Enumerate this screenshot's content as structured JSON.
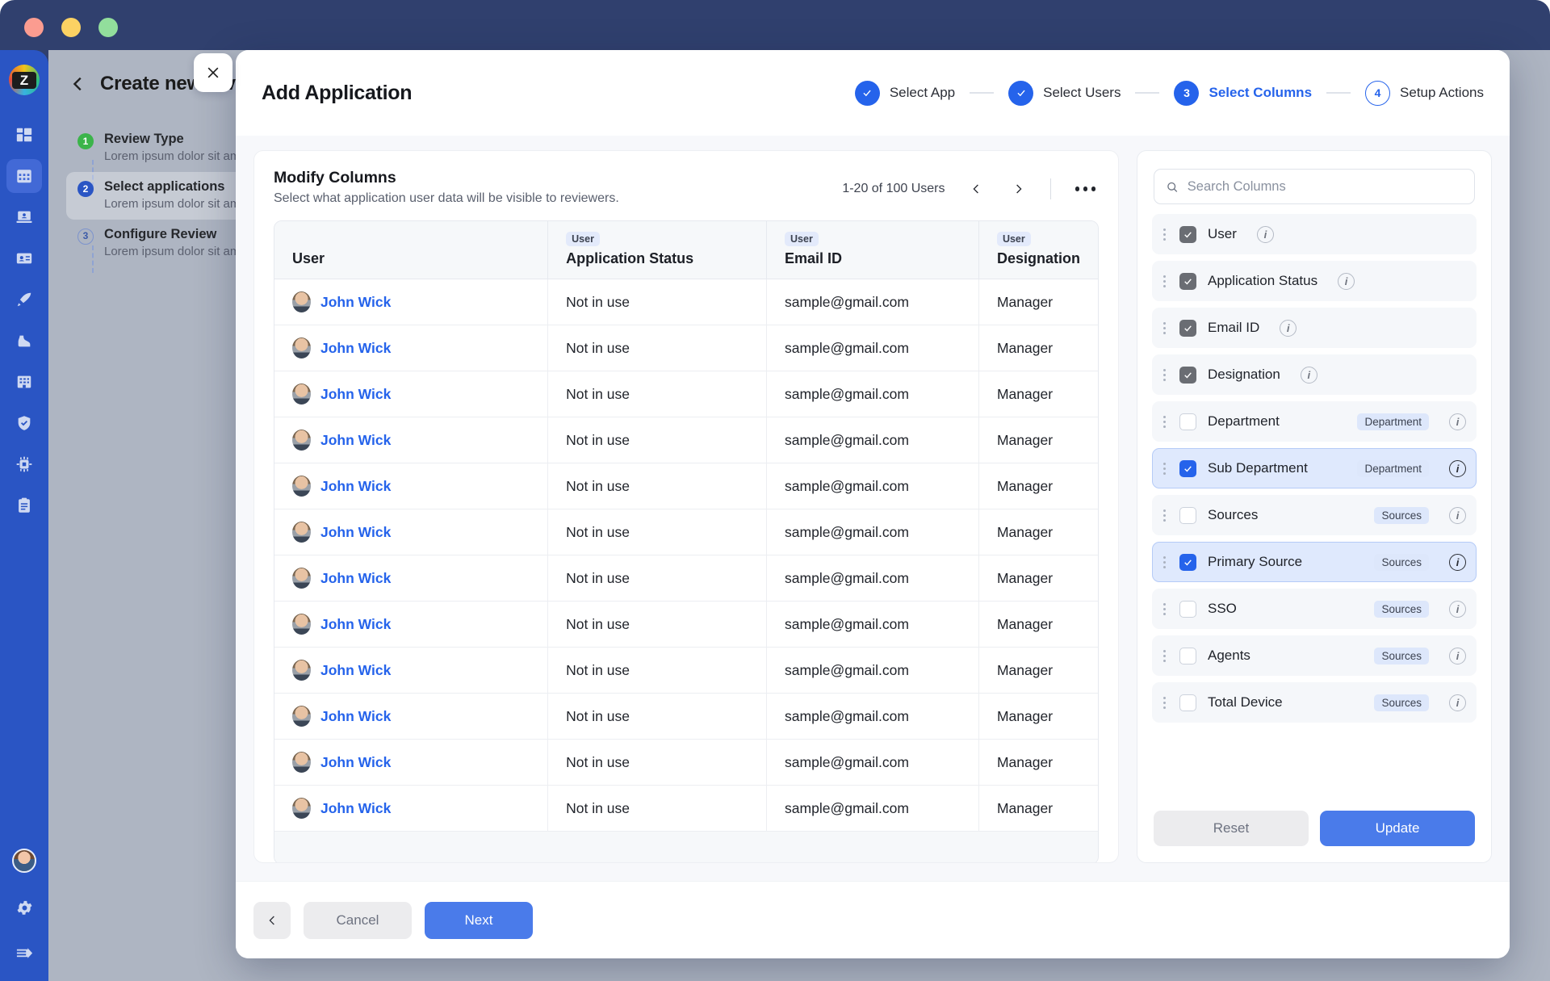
{
  "window": {
    "lights": [
      "close",
      "minimize",
      "maximize"
    ]
  },
  "rail": {
    "logo": "Z",
    "items": [
      {
        "name": "dashboard-icon",
        "active": false
      },
      {
        "name": "calendar-icon",
        "active": true
      },
      {
        "name": "id-card-icon",
        "active": false
      },
      {
        "name": "license-card-icon",
        "active": false
      },
      {
        "name": "rocket-icon",
        "active": false
      },
      {
        "name": "boot-step-icon",
        "active": false
      },
      {
        "name": "building-icon",
        "active": false
      },
      {
        "name": "shield-check-icon",
        "active": false
      },
      {
        "name": "chip-icon",
        "active": false
      },
      {
        "name": "clipboard-icon",
        "active": false
      }
    ],
    "bottom": [
      {
        "name": "user-avatar"
      },
      {
        "name": "settings-gear-icon"
      },
      {
        "name": "collapse-arrow-icon"
      }
    ]
  },
  "backdrop": {
    "breadcrumb": "Create new review",
    "steps": [
      {
        "num": "1",
        "state": "done",
        "title": "Review Type",
        "sub": "Lorem ipsum dolor sit amet"
      },
      {
        "num": "2",
        "state": "active",
        "title": "Select applications",
        "sub": "Lorem ipsum dolor sit amet"
      },
      {
        "num": "3",
        "state": "todo",
        "title": "Configure Review",
        "sub": "Lorem ipsum dolor sit amet"
      }
    ]
  },
  "modal": {
    "title": "Add Application",
    "close_label": "×",
    "stepper": [
      {
        "badge": "✓",
        "label": "Select App",
        "state": "done"
      },
      {
        "badge": "✓",
        "label": "Select Users",
        "state": "done"
      },
      {
        "badge": "3",
        "label": "Select Columns",
        "state": "current"
      },
      {
        "badge": "4",
        "label": "Setup Actions",
        "state": "upcoming"
      }
    ]
  },
  "table_panel": {
    "heading": "Modify Columns",
    "subheading": "Select what application user data will be visible to reviewers.",
    "pagination_text": "1-20 of 100 Users",
    "prev_label": "‹",
    "next_label": "›",
    "more_label": "•••",
    "columns": [
      {
        "chip": "",
        "name": "User"
      },
      {
        "chip": "User",
        "name": "Application Status"
      },
      {
        "chip": "User",
        "name": "Email ID"
      },
      {
        "chip": "User",
        "name": "Designation"
      }
    ],
    "rows": [
      {
        "user": "John Wick",
        "status": "Not in use",
        "email": "sample@gmail.com",
        "designation": "Manager"
      },
      {
        "user": "John Wick",
        "status": "Not in use",
        "email": "sample@gmail.com",
        "designation": "Manager"
      },
      {
        "user": "John Wick",
        "status": "Not in use",
        "email": "sample@gmail.com",
        "designation": "Manager"
      },
      {
        "user": "John Wick",
        "status": "Not in use",
        "email": "sample@gmail.com",
        "designation": "Manager"
      },
      {
        "user": "John Wick",
        "status": "Not in use",
        "email": "sample@gmail.com",
        "designation": "Manager"
      },
      {
        "user": "John Wick",
        "status": "Not in use",
        "email": "sample@gmail.com",
        "designation": "Manager"
      },
      {
        "user": "John Wick",
        "status": "Not in use",
        "email": "sample@gmail.com",
        "designation": "Manager"
      },
      {
        "user": "John Wick",
        "status": "Not in use",
        "email": "sample@gmail.com",
        "designation": "Manager"
      },
      {
        "user": "John Wick",
        "status": "Not in use",
        "email": "sample@gmail.com",
        "designation": "Manager"
      },
      {
        "user": "John Wick",
        "status": "Not in use",
        "email": "sample@gmail.com",
        "designation": "Manager"
      },
      {
        "user": "John Wick",
        "status": "Not in use",
        "email": "sample@gmail.com",
        "designation": "Manager"
      },
      {
        "user": "John Wick",
        "status": "Not in use",
        "email": "sample@gmail.com",
        "designation": "Manager"
      }
    ]
  },
  "columns_panel": {
    "search_placeholder": "Search Columns",
    "search_value": "",
    "items": [
      {
        "label": "User",
        "checked": true,
        "locked": true,
        "selected": false,
        "tag": ""
      },
      {
        "label": "Application Status",
        "checked": true,
        "locked": true,
        "selected": false,
        "tag": ""
      },
      {
        "label": "Email ID",
        "checked": true,
        "locked": true,
        "selected": false,
        "tag": ""
      },
      {
        "label": "Designation",
        "checked": true,
        "locked": true,
        "selected": false,
        "tag": ""
      },
      {
        "label": "Department",
        "checked": false,
        "locked": false,
        "selected": false,
        "tag": "Department"
      },
      {
        "label": "Sub Department",
        "checked": true,
        "locked": false,
        "selected": true,
        "tag": "Department"
      },
      {
        "label": "Sources",
        "checked": false,
        "locked": false,
        "selected": false,
        "tag": "Sources"
      },
      {
        "label": "Primary Source",
        "checked": true,
        "locked": false,
        "selected": true,
        "tag": "Sources"
      },
      {
        "label": "SSO",
        "checked": false,
        "locked": false,
        "selected": false,
        "tag": "Sources"
      },
      {
        "label": "Agents",
        "checked": false,
        "locked": false,
        "selected": false,
        "tag": "Sources"
      },
      {
        "label": "Total Device",
        "checked": false,
        "locked": false,
        "selected": false,
        "tag": "Sources"
      }
    ],
    "reset_label": "Reset",
    "update_label": "Update",
    "info_glyph": "i"
  },
  "footer": {
    "back_label": "‹",
    "cancel_label": "Cancel",
    "next_label": "Next"
  },
  "colors": {
    "chrome_navy": "#30406e",
    "rail_blue": "#2a55c4",
    "accent_blue": "#2563eb",
    "button_blue": "#4a7bea",
    "backdrop_grey": "#aeb5c2",
    "row_grey": "#f5f7fa",
    "row_selected": "#dfe9fd"
  }
}
